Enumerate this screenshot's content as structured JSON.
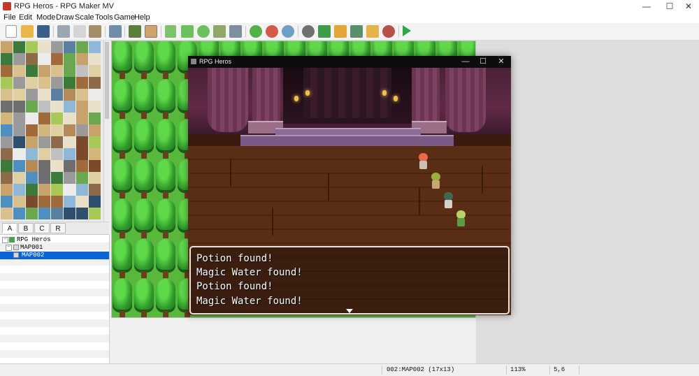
{
  "window": {
    "title": "RPG Heros - RPG Maker MV",
    "minimize_glyph": "—",
    "maximize_glyph": "☐",
    "close_glyph": "✕"
  },
  "menu": [
    "File",
    "Edit",
    "Mode",
    "Draw",
    "Scale",
    "Tools",
    "Game",
    "Help"
  ],
  "toolbar": {
    "icons": [
      "new-project-icon",
      "open-project-icon",
      "save-project-icon",
      "cut-icon",
      "copy-icon",
      "paste-icon",
      "undo-icon",
      "map-mode-icon",
      "event-mode-icon",
      "pencil-icon",
      "rectangle-icon",
      "ellipse-icon",
      "fill-icon",
      "shadow-pen-icon",
      "zoom-in-icon",
      "zoom-out-icon",
      "actual-size-icon",
      "database-icon",
      "plugin-manager-icon",
      "sound-test-icon",
      "event-searcher-icon",
      "resource-manager-icon",
      "character-generator-icon",
      "playtest-icon"
    ]
  },
  "tileset_tabs": [
    "A",
    "B",
    "C",
    "R"
  ],
  "tileset_active_tab": "A",
  "map_tree": [
    {
      "label": "RPG Heros",
      "level": 0,
      "selected": false
    },
    {
      "label": "MAP001",
      "level": 1,
      "selected": false
    },
    {
      "label": "MAP002",
      "level": 2,
      "selected": true
    }
  ],
  "game_window": {
    "title": "RPG Heros",
    "minimize_glyph": "—",
    "maximize_glyph": "☐",
    "close_glyph": "✕"
  },
  "message": {
    "lines": [
      "Potion found!",
      "Magic Water found!",
      "Potion found!",
      "Magic Water found!"
    ]
  },
  "status": {
    "map_info": "002:MAP002 (17x13)",
    "zoom": "113%",
    "coords": "5,6"
  },
  "colors": {
    "selection": "#0a64d6",
    "grass": "#58b83c",
    "message_border": "#e9e4e0"
  }
}
